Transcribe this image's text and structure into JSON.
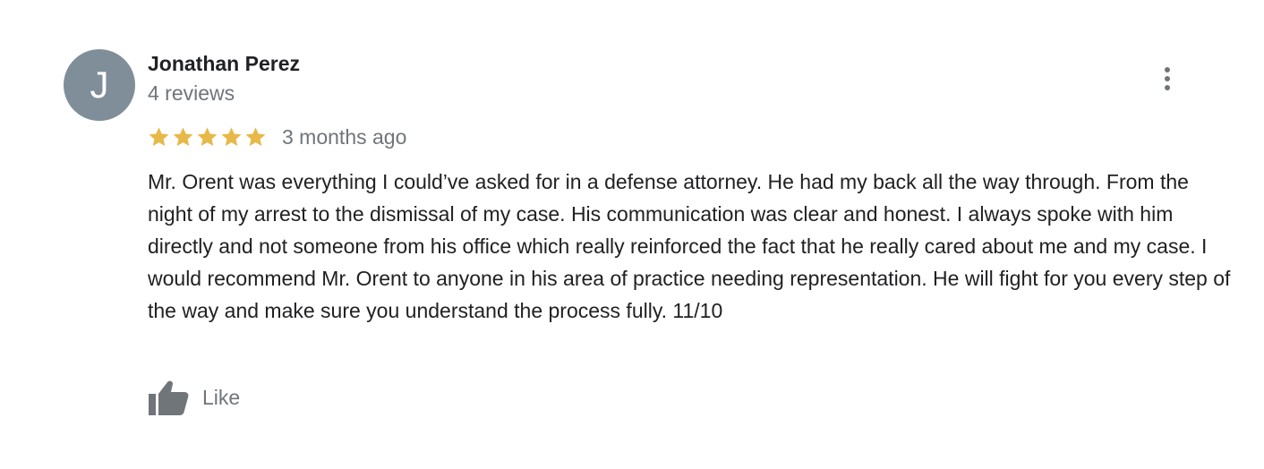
{
  "review": {
    "author": {
      "initial": "J",
      "name": "Jonathan Perez",
      "reviews_count": "4 reviews",
      "avatar_color": "#7f8e99"
    },
    "rating": {
      "stars": 5,
      "max_stars": 5,
      "star_color": "#e7b949",
      "star_icon": "star-icon"
    },
    "date": "3 months ago",
    "text": "Mr. Orent was everything I could’ve asked for in a defense attorney. He had my back all the way through. From the night of my arrest to the dismissal of my case. His communication was clear and honest. I always spoke with him directly and not someone from his office which really reinforced the fact that he really cared about me and my case. I would recommend Mr. Orent to anyone in his area of practice needing representation. He will fight for you every step of the way and make sure you understand the process fully. 11/10",
    "actions": {
      "like_label": "Like",
      "like_icon": "thumbs-up-icon",
      "more_icon": "more-vertical-icon"
    }
  }
}
